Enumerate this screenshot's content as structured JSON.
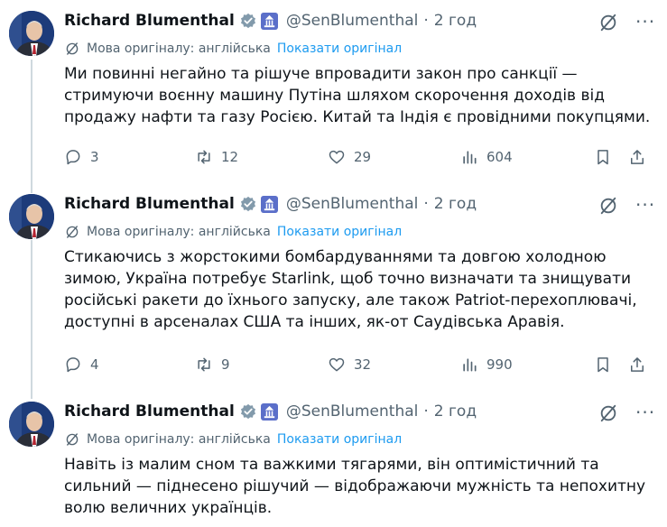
{
  "tweets": [
    {
      "author": "Richard Blumenthal",
      "handle": "@SenBlumenthal",
      "dot": "·",
      "time": "2 год",
      "translation_note": "Мова оригіналу: англійська",
      "show_original": "Показати оригінал",
      "text": "Ми повинні негайно та рішуче впровадити закон про санкції — стримуючи воєнну машину Путіна шляхом скорочення доходів від продажу нафти та газу Росією. Китай та Індія є провідними покупцями.",
      "replies": "3",
      "reposts": "12",
      "likes": "29",
      "views": "604"
    },
    {
      "author": "Richard Blumenthal",
      "handle": "@SenBlumenthal",
      "dot": "·",
      "time": "2 год",
      "translation_note": "Мова оригіналу: англійська",
      "show_original": "Показати оригінал",
      "text": "Стикаючись з жорстокими бомбардуваннями та довгою холодною зимою, Україна потребує Starlink, щоб точно визначати та знищувати російські ракети до їхнього запуску, але також Patriot-перехоплювачі, доступні в арсеналах США та інших, як-от Саудівська Аравія.",
      "replies": "4",
      "reposts": "9",
      "likes": "32",
      "views": "990"
    },
    {
      "author": "Richard Blumenthal",
      "handle": "@SenBlumenthal",
      "dot": "·",
      "time": "2 год",
      "translation_note": "Мова оригіналу: англійська",
      "show_original": "Показати оригінал",
      "text": "Навіть із малим сном та важкими тягарями, він оптимістичний та сильний — піднесено рішучий — відображаючи мужність та непохитну волю величних українців."
    }
  ],
  "colors": {
    "text": "#0f1419",
    "secondary": "#536471",
    "link": "#1d9bf0",
    "thread_line": "#cfd9de",
    "verified_badge": "#829aab"
  }
}
